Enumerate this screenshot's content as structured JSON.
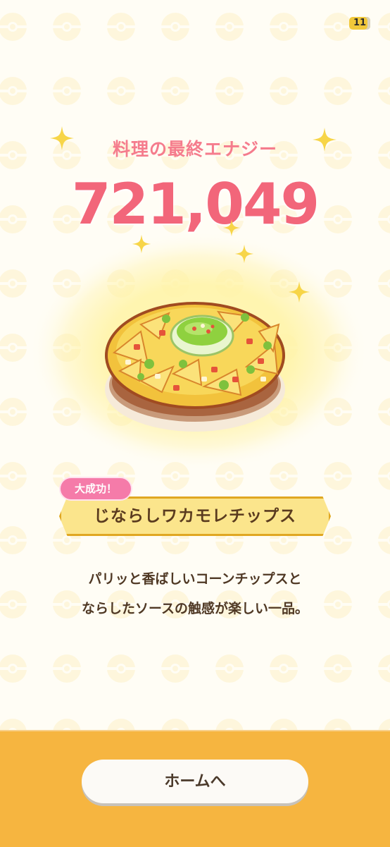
{
  "status": {
    "badge_text": "11"
  },
  "result": {
    "title": "料理の最終エナジー",
    "energy": "721,049"
  },
  "dish": {
    "success_badge": "大成功！",
    "name": "じならしワカモレチップス",
    "description_line1": "パリッと香ばしいコーンチップスと",
    "description_line2": "ならしたソースの触感が楽しい一品。"
  },
  "footer": {
    "home_button": "ホームへ"
  },
  "colors": {
    "accent_pink": "#f2667a",
    "banner_fill": "#fbe58c",
    "banner_border": "#e0a722",
    "footer": "#f6b540"
  }
}
